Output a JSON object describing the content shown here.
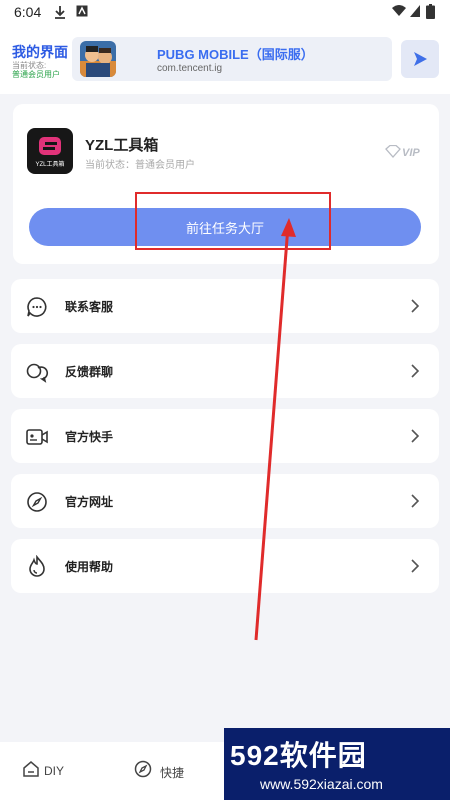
{
  "status_bar": {
    "time": "6:04"
  },
  "header": {
    "title": "我的界面",
    "status_label": "当前状态:",
    "status_value": "普通会员用户",
    "app_name": "PUBG MOBILE（国际服）",
    "app_package": "com.tencent.ig"
  },
  "profile": {
    "logo_text": "YZL工具箱",
    "name": "YZL工具箱",
    "status": "当前状态：普通会员用户",
    "vip_label": "VIP",
    "task_button": "前往任务大厅"
  },
  "menu": {
    "items": [
      {
        "label": "联系客服",
        "icon": "chat-bubble-icon"
      },
      {
        "label": "反馈群聊",
        "icon": "group-chat-icon"
      },
      {
        "label": "官方快手",
        "icon": "video-camera-icon"
      },
      {
        "label": "官方网址",
        "icon": "compass-icon"
      },
      {
        "label": "使用帮助",
        "icon": "flame-icon"
      }
    ]
  },
  "bottom_nav": {
    "items": [
      {
        "label": "DIY",
        "icon": "home-icon"
      },
      {
        "label": "快捷",
        "icon": "compass-icon"
      }
    ]
  },
  "watermark": {
    "main": "592软件园",
    "url": "www.592xiazai.com"
  },
  "colors": {
    "accent_blue": "#6f8ff0",
    "header_title": "#2d5be3",
    "status_green": "#2aa34a",
    "annotation_red": "#e02b2b",
    "watermark_bg": "#0a1f6b"
  }
}
